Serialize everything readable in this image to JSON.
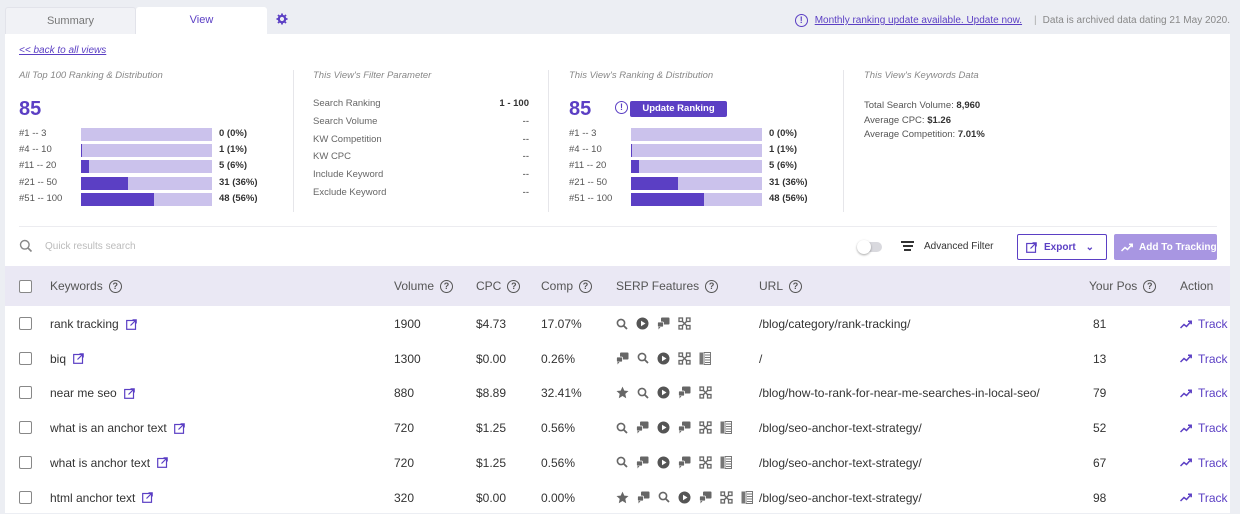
{
  "tabs": {
    "summary": "Summary",
    "view": "View"
  },
  "notice": {
    "link": "Monthly ranking update available. Update now.",
    "archived": "Data is archived data dating 21 May 2020."
  },
  "back_link": "<< back to all views",
  "section1": {
    "title": "All Top 100 Ranking & Distribution",
    "total": "85",
    "rows": [
      {
        "label": "#1 -- 3",
        "value": "0 (0%)",
        "fraction": 0.0
      },
      {
        "label": "#4 -- 10",
        "value": "1 (1%)",
        "fraction": 0.01
      },
      {
        "label": "#11 -- 20",
        "value": "5 (6%)",
        "fraction": 0.06
      },
      {
        "label": "#21 -- 50",
        "value": "31 (36%)",
        "fraction": 0.36
      },
      {
        "label": "#51 -- 100",
        "value": "48 (56%)",
        "fraction": 0.56
      }
    ]
  },
  "section2": {
    "title": "This View's Filter Parameter",
    "rows": [
      {
        "label": "Search Ranking",
        "value": "1 - 100"
      },
      {
        "label": "Search Volume",
        "value": "--"
      },
      {
        "label": "KW Competition",
        "value": "--"
      },
      {
        "label": "KW CPC",
        "value": "--"
      },
      {
        "label": "Include Keyword",
        "value": "--"
      },
      {
        "label": "Exclude Keyword",
        "value": "--"
      }
    ]
  },
  "section3": {
    "title": "This View's Ranking & Distribution",
    "total": "85",
    "update_button": "Update Ranking",
    "rows": [
      {
        "label": "#1 -- 3",
        "value": "0 (0%)",
        "fraction": 0.0
      },
      {
        "label": "#4 -- 10",
        "value": "1 (1%)",
        "fraction": 0.01
      },
      {
        "label": "#11 -- 20",
        "value": "5 (6%)",
        "fraction": 0.06
      },
      {
        "label": "#21 -- 50",
        "value": "31 (36%)",
        "fraction": 0.36
      },
      {
        "label": "#51 -- 100",
        "value": "48 (56%)",
        "fraction": 0.56
      }
    ]
  },
  "section4": {
    "title": "This View's Keywords Data",
    "total_search_volume_label": "Total Search Volume:",
    "total_search_volume": "8,960",
    "avg_cpc_label": "Average CPC:",
    "avg_cpc": "$1.26",
    "avg_comp_label": "Average Competition:",
    "avg_comp": "7.01%"
  },
  "toolbar": {
    "search_placeholder": "Quick results search",
    "advanced_filter": "Advanced Filter",
    "export": "Export",
    "add_to_tracking": "Add To Tracking"
  },
  "table": {
    "headers": {
      "keywords": "Keywords",
      "volume": "Volume",
      "cpc": "CPC",
      "comp": "Comp",
      "serp": "SERP Features",
      "url": "URL",
      "pos": "Your Pos",
      "action": "Action"
    },
    "track_label": "Track",
    "rows": [
      {
        "keyword": "rank tracking",
        "volume": "1900",
        "cpc": "$4.73",
        "comp": "17.07%",
        "serp": [
          "search",
          "video",
          "people-also-ask",
          "sitelinks"
        ],
        "url": "/blog/category/rank-tracking/",
        "pos": "81"
      },
      {
        "keyword": "biq",
        "volume": "1300",
        "cpc": "$0.00",
        "comp": "0.26%",
        "serp": [
          "people-also-ask",
          "search",
          "video",
          "sitelinks",
          "knowledge-panel"
        ],
        "url": "/",
        "pos": "13"
      },
      {
        "keyword": "near me seo",
        "volume": "880",
        "cpc": "$8.89",
        "comp": "32.41%",
        "serp": [
          "star",
          "search",
          "video",
          "people-also-ask",
          "sitelinks"
        ],
        "url": "/blog/how-to-rank-for-near-me-searches-in-local-seo/",
        "pos": "79"
      },
      {
        "keyword": "what is an anchor text",
        "volume": "720",
        "cpc": "$1.25",
        "comp": "0.56%",
        "serp": [
          "search",
          "people-also-ask",
          "video",
          "people-also-ask",
          "sitelinks",
          "knowledge-panel"
        ],
        "url": "/blog/seo-anchor-text-strategy/",
        "pos": "52"
      },
      {
        "keyword": "what is anchor text",
        "volume": "720",
        "cpc": "$1.25",
        "comp": "0.56%",
        "serp": [
          "search",
          "people-also-ask",
          "video",
          "people-also-ask",
          "sitelinks",
          "knowledge-panel"
        ],
        "url": "/blog/seo-anchor-text-strategy/",
        "pos": "67"
      },
      {
        "keyword": "html anchor text",
        "volume": "320",
        "cpc": "$0.00",
        "comp": "0.00%",
        "serp": [
          "star",
          "people-also-ask",
          "search",
          "video",
          "people-also-ask",
          "sitelinks",
          "knowledge-panel"
        ],
        "url": "/blog/seo-anchor-text-strategy/",
        "pos": "98"
      }
    ]
  },
  "colors": {
    "accent": "#5b3fc4",
    "bar_bg": "#cbc2ec",
    "header_bg": "#eae8f4"
  }
}
